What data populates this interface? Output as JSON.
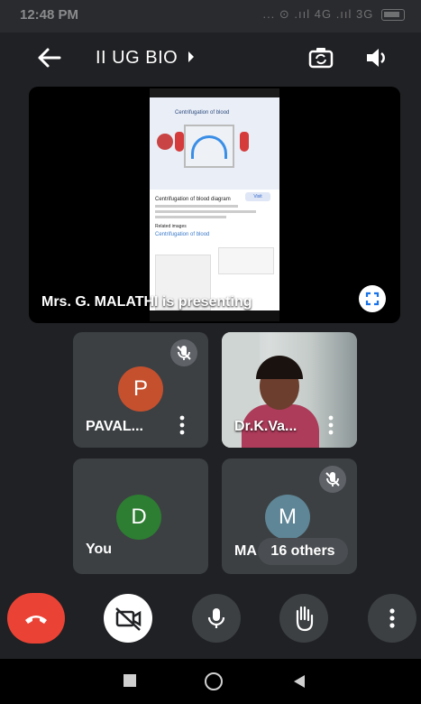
{
  "status_bar": {
    "time": "12:48 PM",
    "icons": "... ⊙ .ııl 4G .ııl 3G",
    "battery_icon": "battery-icon"
  },
  "header": {
    "meeting_title": "II UG BIO",
    "back_icon": "back-arrow-icon",
    "caret_icon": "caret-right-icon",
    "switch_camera_icon": "switch-camera-icon",
    "speaker_icon": "speaker-icon"
  },
  "presentation": {
    "presenter_label": "Mrs. G. MALATHI is presenting",
    "shared_screen": {
      "heading": "Centrifugation of blood",
      "result_title": "Centrifugation of blood diagram",
      "visit_label": "Visit",
      "related_label": "Related images",
      "related_link": "Centrifugation of blood"
    },
    "fullscreen_icon": "fullscreen-icon"
  },
  "participants": [
    {
      "initial": "P",
      "name": "PAVAL...",
      "color": "#c5502e",
      "muted": true
    },
    {
      "initial": "",
      "name": "Dr.K.Va...",
      "video": true,
      "muted": false
    },
    {
      "initial": "D",
      "name": "You",
      "color": "#2d7d32",
      "muted": false
    },
    {
      "initial": "M",
      "name": "MA",
      "color": "#5f8696",
      "muted": true,
      "others_label": "16 others"
    }
  ],
  "controls": {
    "end_call_icon": "end-call-icon",
    "camera_off_icon": "camera-off-icon",
    "mic_icon": "mic-icon",
    "raise_hand_icon": "raise-hand-icon",
    "more_icon": "more-options-icon",
    "colors": {
      "end_call": "#ea4335",
      "camera_off_bg": "#ffffff",
      "control_bg": "#3c4043"
    }
  },
  "nav": {
    "recents_icon": "recents-icon",
    "home_icon": "home-icon",
    "back_icon": "nav-back-icon"
  }
}
